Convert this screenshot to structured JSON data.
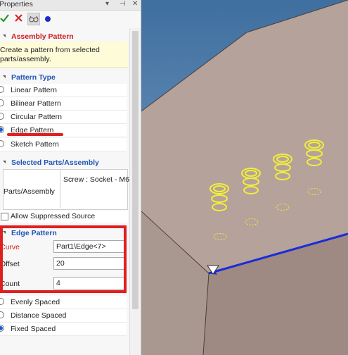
{
  "panel": {
    "title": "Properties",
    "controls": {
      "dropdown": "▾",
      "pin": "⊣",
      "close": "✕"
    }
  },
  "toolbar": {
    "ok_icon": "check-icon",
    "cancel_icon": "close-icon",
    "preview_icon": "glasses-icon",
    "dot_icon": "dot-icon"
  },
  "assembly_pattern": {
    "heading": "Assembly Pattern",
    "description": "Create a pattern from selected parts/assembly."
  },
  "pattern_type": {
    "heading": "Pattern Type",
    "options": [
      {
        "label": "Linear Pattern",
        "selected": false
      },
      {
        "label": "Bilinear Pattern",
        "selected": false
      },
      {
        "label": "Circular Pattern",
        "selected": false
      },
      {
        "label": "Edge Pattern",
        "selected": true
      },
      {
        "label": "Sketch Pattern",
        "selected": false
      }
    ]
  },
  "selected_parts": {
    "heading": "Selected Parts/Assembly",
    "label": "Parts/Assembly",
    "value": "Screw : Socket - M6"
  },
  "allow_suppressed": {
    "label": "Allow Suppressed Source",
    "checked": false
  },
  "edge_pattern": {
    "heading": "Edge Pattern",
    "curve_label": "Curve",
    "curve_value": "Part1\\Edge<7>",
    "offset_label": "Offset",
    "offset_value": "20",
    "count_label": "Count",
    "count_value": "4"
  },
  "spacing": {
    "options": [
      {
        "label": "Evenly Spaced",
        "selected": false
      },
      {
        "label": "Distance Spaced",
        "selected": false
      },
      {
        "label": "Fixed Spaced",
        "selected": true
      }
    ]
  },
  "colors": {
    "accent_blue": "#1f55b5",
    "required_red": "#cc1b1b",
    "annotation_red": "#e02020",
    "preview_yellow": "#f2ee3a",
    "edge_blue": "#1a2bd8",
    "part_face": "#b7a39a",
    "background_sky": "#6f94bf"
  }
}
